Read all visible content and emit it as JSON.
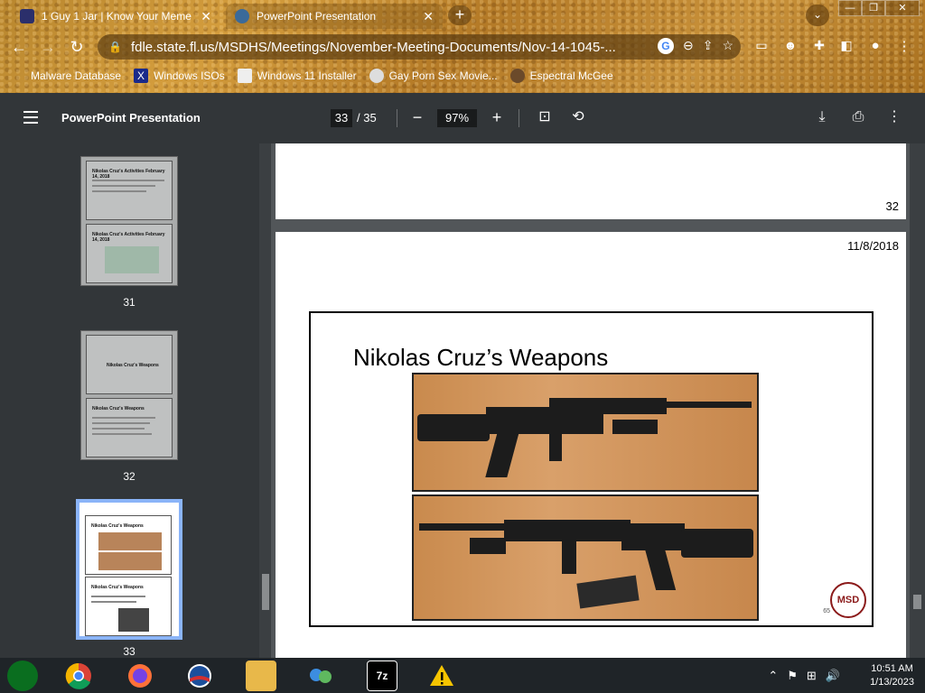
{
  "browser": {
    "tabs": [
      {
        "title": "1 Guy 1 Jar | Know Your Meme",
        "icon": "knowyourmeme-icon"
      },
      {
        "title": "PowerPoint Presentation",
        "icon": "globe-icon"
      }
    ],
    "new_tab_label": "+",
    "url": "fdle.state.fl.us/MSDHS/Meetings/November-Meeting-Documents/Nov-14-1045-...",
    "bookmarks": [
      {
        "label": "Malware Database"
      },
      {
        "label": "Windows ISOs"
      },
      {
        "label": "Windows 11 Installer"
      },
      {
        "label": "Gay Porn Sex Movie..."
      },
      {
        "label": "Espectral McGee"
      }
    ],
    "window_controls": {
      "minimize": "—",
      "restore": "❐",
      "close": "✕"
    }
  },
  "pdf": {
    "title": "PowerPoint Presentation",
    "current_page": "33",
    "total_pages": "/ 35",
    "zoom": "97%",
    "thumbnails": [
      {
        "label": "31",
        "title": "Nikolas Cruz's Activities February 14, 2018"
      },
      {
        "label": "32",
        "title": "Nikolas Cruz's Weapons"
      },
      {
        "label": "33",
        "title": "Nikolas Cruz's Weapons"
      }
    ],
    "prev_page_number": "32",
    "page_date": "11/8/2018",
    "slide_title": "Nikolas Cruz’s Weapons",
    "slide_number": "65",
    "logo_text": "MSD"
  },
  "taskbar": {
    "apps": [
      "media-center-icon",
      "chrome-icon",
      "firefox-icon",
      "obama-icon",
      "file-explorer-icon",
      "network-icon",
      "7zip-icon",
      "warning-app-icon"
    ],
    "sevenzip_label": "7z",
    "time": "10:51 AM",
    "date": "1/13/2023"
  }
}
